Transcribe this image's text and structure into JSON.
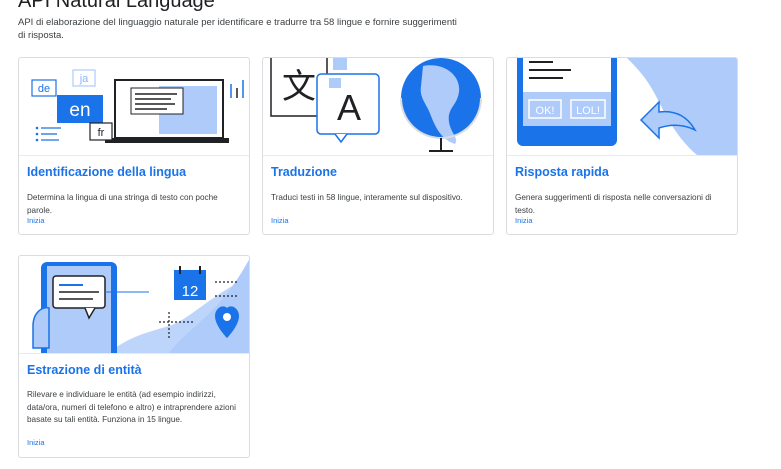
{
  "page": {
    "title": "API Natural Language",
    "description": "API di elaborazione del linguaggio naturale per identificare e tradurre tra 58 lingue e fornire suggerimenti di risposta."
  },
  "cards": [
    {
      "title": "Identificazione della lingua",
      "description": "Determina la lingua di una stringa di testo con poche parole.",
      "link": "Inizia",
      "illustration": {
        "codes": [
          "de",
          "ja",
          "en",
          "fr"
        ]
      }
    },
    {
      "title": "Traduzione",
      "description": "Traduci testi in 58 lingue, interamente sul dispositivo.",
      "link": "Inizia",
      "illustration": {
        "glyphs": [
          "文",
          "A"
        ]
      }
    },
    {
      "title": "Risposta rapida",
      "description": "Genera suggerimenti di risposta nelle conversazioni di testo.",
      "link": "Inizia",
      "illustration": {
        "chips": [
          "OK!",
          "LOL!"
        ]
      }
    },
    {
      "title": "Estrazione di entità",
      "description": "Rilevare e individuare le entità (ad esempio indirizzi, data/ora, numeri di telefono e altro) e intraprendere azioni basate su tali entità. Funziona in 15 lingue.",
      "link": "Inizia",
      "illustration": {
        "calendar_day": "12"
      }
    }
  ],
  "colors": {
    "accent": "#1a73e8",
    "light_blue": "#aecbfa",
    "mid_blue": "#4285f4",
    "border": "#dadce0"
  }
}
